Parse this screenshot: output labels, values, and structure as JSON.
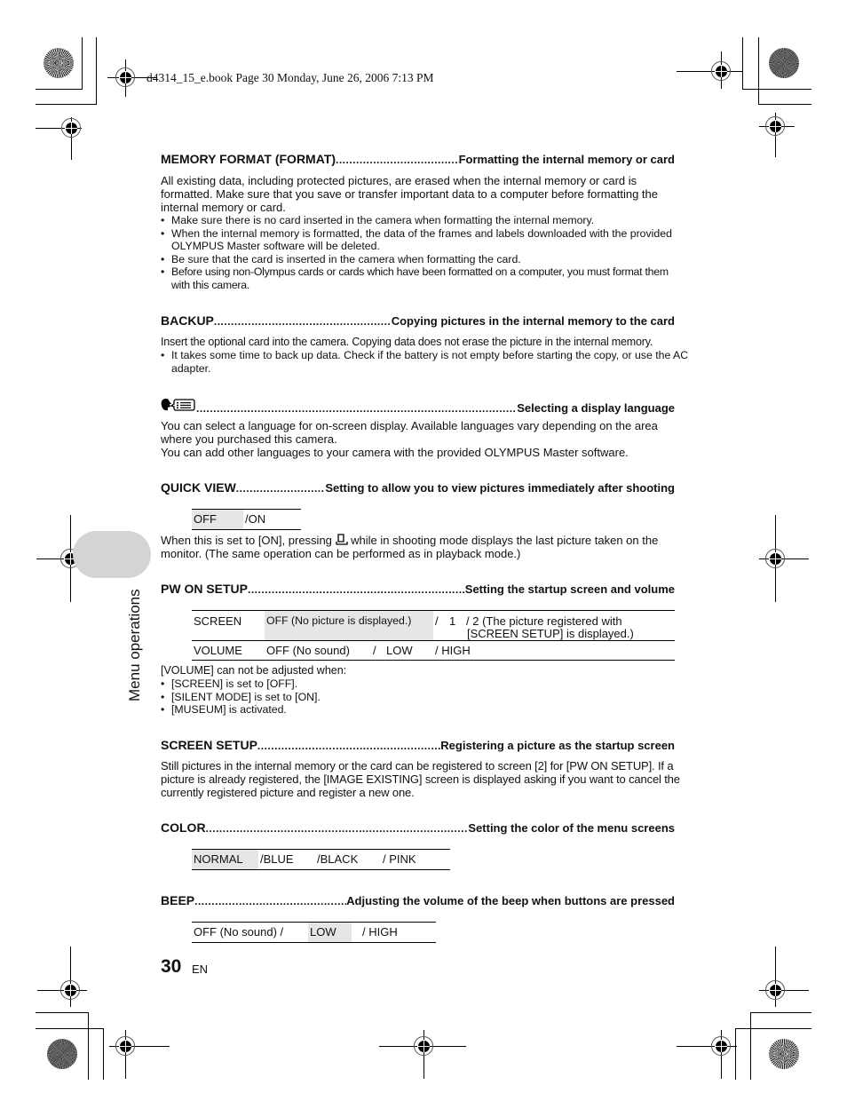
{
  "header": {
    "file_stamp": "d4314_15_e.book  Page 30  Monday, June 26, 2006  7:13 PM"
  },
  "side_tab": {
    "label": "Menu operations"
  },
  "sections": {
    "memory_format": {
      "name": "MEMORY FORMAT (FORMAT)",
      "desc": "Formatting the internal memory or card",
      "body": "All existing data, including protected pictures, are erased when the internal memory or card is formatted. Make sure that you save or transfer important data to a computer before formatting the internal memory or card.",
      "bullets": [
        "Make sure there is no card inserted in the camera when formatting the internal memory.",
        "When the internal memory is formatted, the data of the frames and labels downloaded with the provided OLYMPUS Master software will be deleted.",
        "Be sure that the card is inserted in the camera when formatting the card.",
        "Before using non-Olympus cards or cards which have been formatted on a computer, you must format them with this camera."
      ]
    },
    "backup": {
      "name": "BACKUP",
      "desc": "Copying pictures in the internal memory to the card",
      "body": "Insert the optional card into the camera. Copying data does not erase the picture in the internal memory.",
      "bullets": [
        "It takes some time to back up data. Check if the battery is not empty before starting the copy, or use the AC adapter."
      ]
    },
    "language": {
      "icon": "language-icon",
      "desc": "Selecting a display language",
      "body_1": "You can select a language for on-screen display. Available languages vary depending on the area where you purchased this camera.",
      "body_2": "You can add other languages to your camera with the provided OLYMPUS Master software."
    },
    "quick_view": {
      "name": "QUICK VIEW",
      "desc": "Setting to allow you to view pictures immediately after shooting",
      "options": [
        "OFF",
        "/ON"
      ],
      "selected": "OFF",
      "body_pre": "When this is set to [ON], pressing",
      "body_icon": "playback-icon",
      "body_post": "while in shooting mode displays the last picture taken on the monitor. (The same operation can be performed as in playback mode.)"
    },
    "pw_on_setup": {
      "name": "PW ON SETUP",
      "desc": "Setting the startup screen and volume",
      "rows": [
        {
          "label": "SCREEN",
          "options": [
            "OFF (No picture is displayed.)",
            "/",
            "1",
            "/ 2 (The picture registered with",
            "[SCREEN SETUP] is displayed.)"
          ],
          "selected": "OFF (No picture is displayed.)"
        },
        {
          "label": "VOLUME",
          "options": [
            "OFF (No sound)",
            "/",
            "LOW",
            "/ HIGH"
          ],
          "selected": ""
        }
      ],
      "note": "[VOLUME] can not be adjusted when:",
      "bullets": [
        "[SCREEN] is set to [OFF].",
        "[SILENT MODE] is set to [ON].",
        "[MUSEUM] is activated."
      ]
    },
    "screen_setup": {
      "name": "SCREEN SETUP",
      "desc": "Registering a picture as the startup screen",
      "body": "Still pictures in the internal memory or the card can be registered to screen [2] for [PW ON SETUP]. If a picture is already registered, the [IMAGE EXISTING] screen is displayed asking if you want to cancel the currently registered picture and register a new one."
    },
    "color": {
      "name": "COLOR",
      "desc": "Setting the color of the menu screens",
      "options": [
        "NORMAL",
        "/BLUE",
        "/BLACK",
        "/ PINK"
      ],
      "selected": "NORMAL"
    },
    "beep": {
      "name": "BEEP",
      "desc": "Adjusting the volume of the beep when buttons are pressed",
      "options": [
        "OFF (No sound) /",
        "LOW",
        "/ HIGH"
      ],
      "selected": "LOW"
    }
  },
  "footer": {
    "page_number": "30",
    "lang": "EN"
  },
  "colors": {
    "highlight": "#e6e6e6",
    "side_tab": "#d4d4d4"
  }
}
